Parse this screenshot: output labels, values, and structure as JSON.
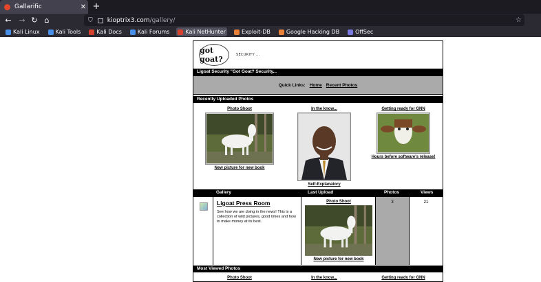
{
  "browser": {
    "tab_title": "Gallarific",
    "tab_close": "✕",
    "new_tab": "+",
    "url_host": "kioptrix3.com",
    "url_path": "/gallery/",
    "bookmarks": [
      {
        "label": "Kali Linux",
        "color": "#4a8fe7"
      },
      {
        "label": "Kali Tools",
        "color": "#4a8fe7"
      },
      {
        "label": "Kali Docs",
        "color": "#d6402f"
      },
      {
        "label": "Kali Forums",
        "color": "#4a8fe7"
      },
      {
        "label": "Kali NetHunter",
        "color": "#d6402f"
      },
      {
        "label": "Exploit-DB",
        "color": "#e8823a"
      },
      {
        "label": "Google Hacking DB",
        "color": "#e8823a"
      },
      {
        "label": "OffSec",
        "color": "#7a7ae0"
      }
    ]
  },
  "site": {
    "logo_text": "got goat?",
    "tagline": "SECURITY ...",
    "title_bar": "Ligoat Security \"Got Goat? Security...",
    "quick_links_label": "Quick Links:",
    "quick_links": [
      "Home",
      "Recent Photos"
    ],
    "recent_heading": "Recently Uploaded Photos",
    "recent_photos": [
      {
        "title": "Photo Shoot",
        "caption": "New picture for new book"
      },
      {
        "title": "In the know...",
        "caption": "Self-Explanatory"
      },
      {
        "title": "Getting ready for GNN",
        "caption": "Hours before software's release!"
      }
    ],
    "gallery_headers": {
      "gallery": "Gallery",
      "last_upload": "Last Upload",
      "photos": "Photos",
      "views": "Views"
    },
    "gallery": {
      "name": "Ligoat Press Room",
      "description": "See how we are doing in the news! This is a collection of wild pictures, good times and how to make money at its best.",
      "last_upload_title": "Photo Shoot",
      "last_upload_caption": "New picture for new book",
      "photos": "3",
      "views": "21"
    },
    "most_viewed_heading": "Most Viewed Photos",
    "most_viewed": [
      "Photo Shoot",
      "In the know...",
      "Getting ready for GNN"
    ]
  }
}
